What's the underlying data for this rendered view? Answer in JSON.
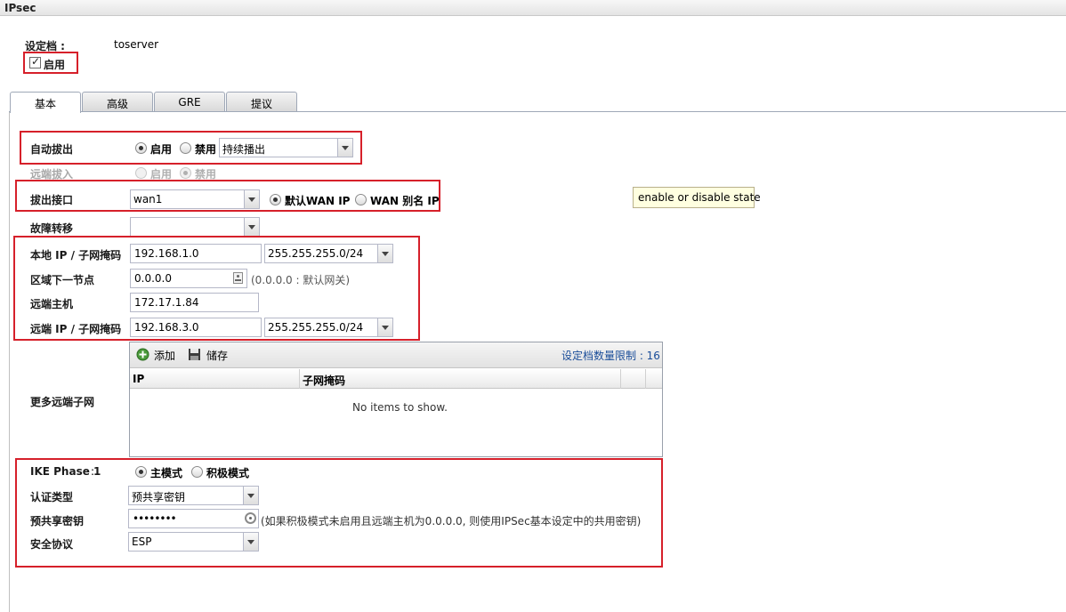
{
  "window": {
    "title": "IPsec"
  },
  "profile": {
    "label": "设定档 :",
    "value": "toserver"
  },
  "enable": {
    "label": "启用",
    "checked": true
  },
  "tabs": [
    {
      "label": "基本",
      "active": true
    },
    {
      "label": "高级",
      "active": false
    },
    {
      "label": "GRE",
      "active": false
    },
    {
      "label": "提议",
      "active": false
    }
  ],
  "auto_dialout": {
    "label": "自动拔出",
    "option_on": "启用",
    "option_off": "禁用",
    "selected": "启用",
    "mode_value": "持续播出"
  },
  "remote_dialin": {
    "label": "远端拔入",
    "option_on": "启用",
    "option_off": "禁用",
    "selected": "禁用",
    "disabled": true
  },
  "dialout_interface": {
    "label": "拔出接口",
    "value": "wan1",
    "option_default": "默认WAN IP",
    "option_alias": "WAN 别名 IP",
    "selected": "默认WAN IP"
  },
  "failover": {
    "label": "故障转移",
    "value": ""
  },
  "local_ip": {
    "label": "本地 IP / 子网掩码",
    "ip": "192.168.1.0",
    "mask": "255.255.255.0/24"
  },
  "next_hop": {
    "label": "区域下一节点",
    "value": "0.0.0.0",
    "hint": "(0.0.0.0 : 默认网关)"
  },
  "remote_host": {
    "label": "远端主机",
    "value": "172.17.1.84"
  },
  "remote_ip": {
    "label": "远端 IP / 子网掩码",
    "ip": "192.168.3.0",
    "mask": "255.255.255.0/24"
  },
  "more_subnets": {
    "label": "更多远端子网",
    "add_label": "添加",
    "save_label": "储存",
    "limit_label": "设定档数量限制 : 16",
    "columns": [
      "IP",
      "子网掩码"
    ],
    "empty_text": "No items to show."
  },
  "tooltip": {
    "text": "enable or disable state"
  },
  "ike_phase1": {
    "label": "IKE Phase 1",
    "option_main": "主模式",
    "option_aggressive": "积极模式",
    "selected": "主模式"
  },
  "auth_type": {
    "label": "认证类型",
    "value": "预共享密钥"
  },
  "psk": {
    "label": "预共享密钥",
    "value": "••••••••",
    "hint": "(如果积极模式未启用且远端主机为0.0.0.0, 则使用IPSec基本设定中的共用密钥)"
  },
  "security_protocol": {
    "label": "安全协议",
    "value": "ESP"
  },
  "colors": {
    "highlight_border": "#d6202a",
    "tooltip_bg": "#ffffe0"
  }
}
